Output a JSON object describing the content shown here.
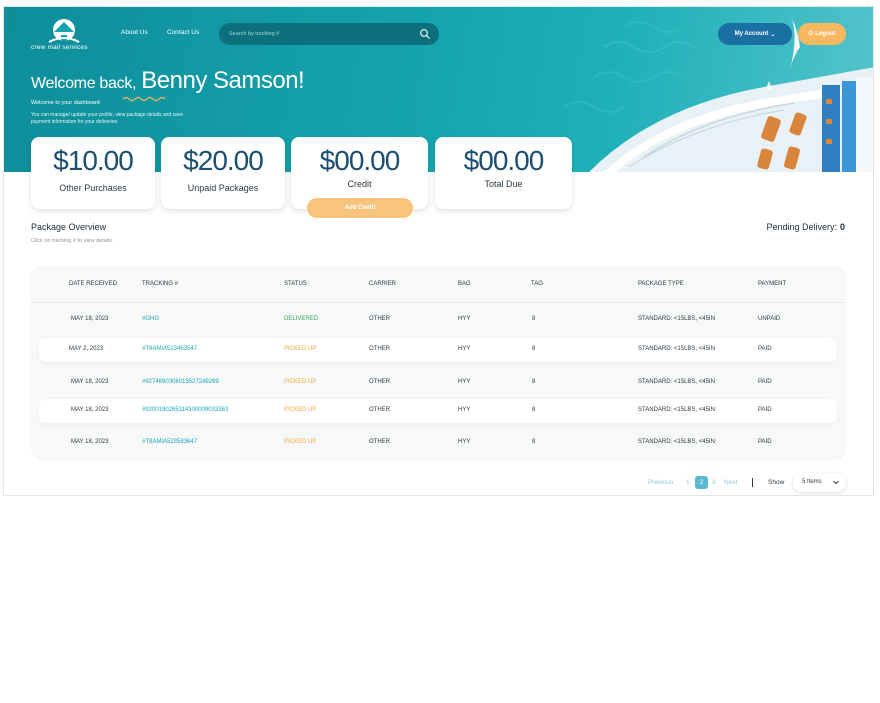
{
  "brand": {
    "name": "crew mail services"
  },
  "nav": {
    "about": "About Us",
    "contact": "Contact Us"
  },
  "search": {
    "placeholder": "Search by tracking #"
  },
  "header": {
    "account_label": "My Account",
    "logout_label": "Logout"
  },
  "welcome": {
    "greeting": "Welcome back,",
    "name": "Benny Samson!",
    "subtitle": "Welcome to your dashboard",
    "desc": "You can manage/ update your profile, view package details and save payment information for your deliveries."
  },
  "cards": [
    {
      "amount": "$10.00",
      "label": "Other Purchases"
    },
    {
      "amount": "$20.00",
      "label": "Unpaid Packages"
    },
    {
      "amount": "$00.00",
      "label": "Credit",
      "button": "Add Credit"
    },
    {
      "amount": "$00.00",
      "label": "Total Due"
    }
  ],
  "overview": {
    "title": "Package Overview",
    "hint": "Click on tracking # to view details.",
    "pending_label": "Pending Delivery:",
    "pending_count": "0"
  },
  "table": {
    "columns": [
      "DATE RECEIVED",
      "TRACKING #",
      "STATUS",
      "CARRIER",
      "BAG",
      "TAG",
      "PACKAGE TYPE",
      "PAYMENT"
    ],
    "rows": [
      {
        "date": "MAY 18, 2023",
        "tracking": "#GHG",
        "status": "DELIVERED",
        "carrier": "OTHER",
        "bag": "HYY",
        "tag": "8",
        "type": "STANDARD: <15LBS, <45IN",
        "payment": "UNPAID"
      },
      {
        "date": "MAY 2, 2023",
        "tracking": "#T8AMIA523463547",
        "status": "PICKED UP",
        "carrier": "OTHER",
        "bag": "HYY",
        "tag": "8",
        "type": "STANDARD: <15LBS, <45IN",
        "payment": "PAID"
      },
      {
        "date": "MAY 18, 2023",
        "tracking": "#9274890306013527249269",
        "status": "PICKED UP",
        "carrier": "OTHER",
        "bag": "HYY",
        "tag": "8",
        "type": "STANDARD: <15LBS, <45IN",
        "payment": "PAID"
      },
      {
        "date": "MAY 18, 2023",
        "tracking": "#9200190265114300009033363",
        "status": "PICKED UP",
        "carrier": "OTHER",
        "bag": "HYY",
        "tag": "8",
        "type": "STANDARD: <15LBS, <45IN",
        "payment": "PAID"
      },
      {
        "date": "MAY 18, 2023",
        "tracking": "#T8AMIA523583647",
        "status": "PICKED UP",
        "carrier": "OTHER",
        "bag": "HYY",
        "tag": "8",
        "type": "STANDARD: <15LBS, <45IN",
        "payment": "PAID"
      }
    ]
  },
  "pagination": {
    "previous": "Previous",
    "pages": [
      "1",
      "2",
      "3"
    ],
    "active": "2",
    "next": "Next",
    "show_label": "Show",
    "page_size": "5 Items"
  },
  "colors": {
    "teal": "#14a3ad",
    "navy": "#1b4f72",
    "accent_orange": "#f8b860",
    "account_blue": "#1a6fa3",
    "delivered_green": "#32a852",
    "picked_orange": "#f0a63c",
    "tracking_link": "#1aa5b8"
  }
}
